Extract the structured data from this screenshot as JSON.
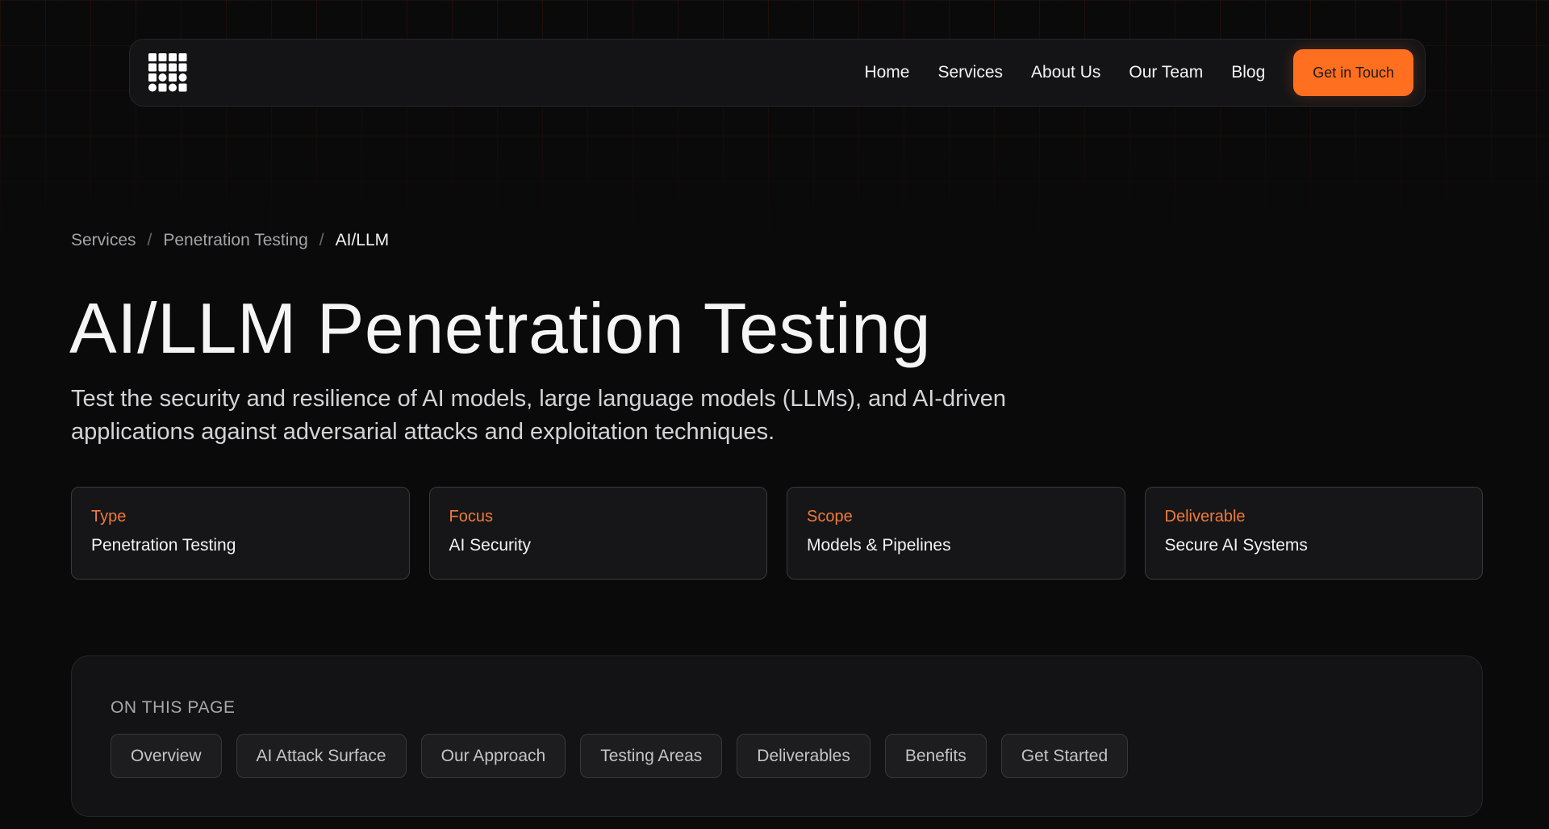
{
  "nav": {
    "logo_icon": "grid-logo-icon",
    "links": [
      {
        "label": "Home"
      },
      {
        "label": "Services"
      },
      {
        "label": "About Us"
      },
      {
        "label": "Our Team"
      },
      {
        "label": "Blog"
      }
    ],
    "cta_label": "Get in Touch"
  },
  "breadcrumb": {
    "items": [
      "Services",
      "Penetration Testing",
      "AI/LLM"
    ],
    "separator": "/"
  },
  "hero": {
    "title": "AI/LLM Penetration Testing",
    "subtitle": "Test the security and resilience of AI models, large language models (LLMs), and AI-driven applications against adversarial attacks and exploitation techniques."
  },
  "cards": [
    {
      "label": "Type",
      "value": "Penetration Testing"
    },
    {
      "label": "Focus",
      "value": "AI Security"
    },
    {
      "label": "Scope",
      "value": "Models & Pipelines"
    },
    {
      "label": "Deliverable",
      "value": "Secure AI Systems"
    }
  ],
  "toc": {
    "heading": "ON THIS PAGE",
    "chips": [
      "Overview",
      "AI Attack Surface",
      "Our Approach",
      "Testing Areas",
      "Deliverables",
      "Benefits",
      "Get Started"
    ]
  },
  "colors": {
    "accent": "#ff6f1f",
    "card_label": "#f07a3a",
    "background": "#0a0a0b"
  }
}
